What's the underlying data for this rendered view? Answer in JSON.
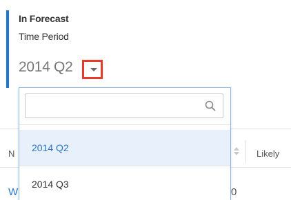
{
  "filter": {
    "title": "In Forecast",
    "subtitle": "Time Period",
    "selected_value": "2014 Q2"
  },
  "dropdown": {
    "search_placeholder": "",
    "options": [
      {
        "label": "2014 Q2",
        "selected": true
      },
      {
        "label": "2014 Q3",
        "selected": false
      }
    ]
  },
  "background_table": {
    "col1_header_fragment": "N",
    "col3_header": "Likely",
    "row1_link_fragment": "W",
    "row1_value_fragment": "0"
  },
  "colors": {
    "accent": "#1f76d4",
    "highlight_border": "#e8392b",
    "selected_bg": "#e8f1fb",
    "selected_text": "#2a76c6",
    "link": "#2a76c6"
  },
  "icons": {
    "caret": "chevron-down-icon",
    "search": "search-icon"
  }
}
